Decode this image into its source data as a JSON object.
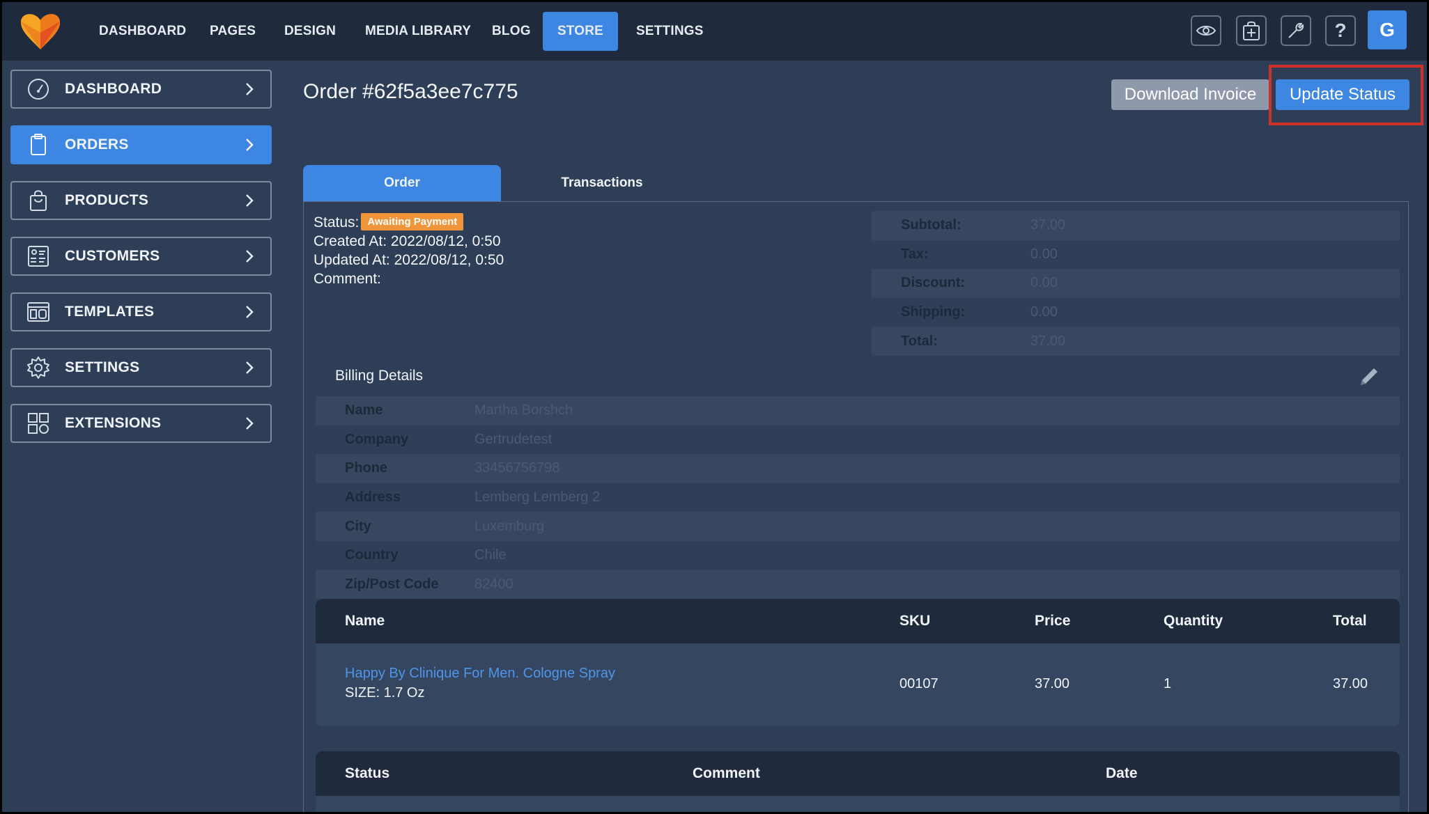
{
  "nav": {
    "items": [
      {
        "label": "DASHBOARD"
      },
      {
        "label": "PAGES"
      },
      {
        "label": "DESIGN"
      },
      {
        "label": "MEDIA LIBRARY"
      },
      {
        "label": "BLOG"
      },
      {
        "label": "STORE"
      },
      {
        "label": "SETTINGS"
      }
    ],
    "active": "STORE",
    "tools": [
      "eye-icon",
      "bag-add-icon",
      "wrench-icon",
      "help-icon"
    ],
    "avatar_initial": "G"
  },
  "sidebar": {
    "items": [
      {
        "label": "DASHBOARD",
        "icon": "gauge-icon"
      },
      {
        "label": "ORDERS",
        "icon": "clipboard-icon"
      },
      {
        "label": "PRODUCTS",
        "icon": "shopping-bag-icon"
      },
      {
        "label": "CUSTOMERS",
        "icon": "contacts-icon"
      },
      {
        "label": "TEMPLATES",
        "icon": "layout-icon"
      },
      {
        "label": "SETTINGS",
        "icon": "gear-icon"
      },
      {
        "label": "EXTENSIONS",
        "icon": "grid-icon"
      }
    ],
    "active": "ORDERS"
  },
  "order": {
    "title": "Order #62f5a3ee7c775",
    "download_label": "Download Invoice",
    "update_label": "Update Status",
    "tabs": [
      "Order",
      "Transactions"
    ],
    "status_label": "Status:",
    "status_value": "Awaiting Payment",
    "created": "Created At: 2022/08/12, 0:50",
    "updated": "Updated At: 2022/08/12, 0:50",
    "comment": "Comment:"
  },
  "totals": [
    {
      "label": "Subtotal:",
      "value": "37.00"
    },
    {
      "label": "Tax:",
      "value": "0.00"
    },
    {
      "label": "Discount:",
      "value": "0.00"
    },
    {
      "label": "Shipping:",
      "value": "0.00"
    },
    {
      "label": "Total:",
      "value": "37.00"
    }
  ],
  "billing": {
    "title": "Billing Details",
    "rows": [
      {
        "label": "Name",
        "value": "Martha Borshch"
      },
      {
        "label": "Company",
        "value": "Gertrudetest"
      },
      {
        "label": "Phone",
        "value": "33456756798"
      },
      {
        "label": "Address",
        "value": "Lemberg Lemberg 2"
      },
      {
        "label": "City",
        "value": "Luxemburg"
      },
      {
        "label": "Country",
        "value": "Chile"
      },
      {
        "label": "Zip/Post Code",
        "value": "82400"
      }
    ]
  },
  "items_table": {
    "headers": {
      "name": "Name",
      "sku": "SKU",
      "price": "Price",
      "quantity": "Quantity",
      "total": "Total"
    },
    "rows": [
      {
        "name": "Happy By Clinique For Men. Cologne Spray",
        "option": "SIZE: 1.7 Oz",
        "sku": "00107",
        "price": "37.00",
        "quantity": "1",
        "total": "37.00"
      }
    ]
  },
  "status_table": {
    "headers": {
      "status": "Status",
      "comment": "Comment",
      "date": "Date"
    }
  },
  "colors": {
    "accent": "#3d87e3",
    "highlight": "#d0322a",
    "badge": "#f0953a",
    "topbar": "#1f2b3d",
    "background": "#2e3e57"
  }
}
